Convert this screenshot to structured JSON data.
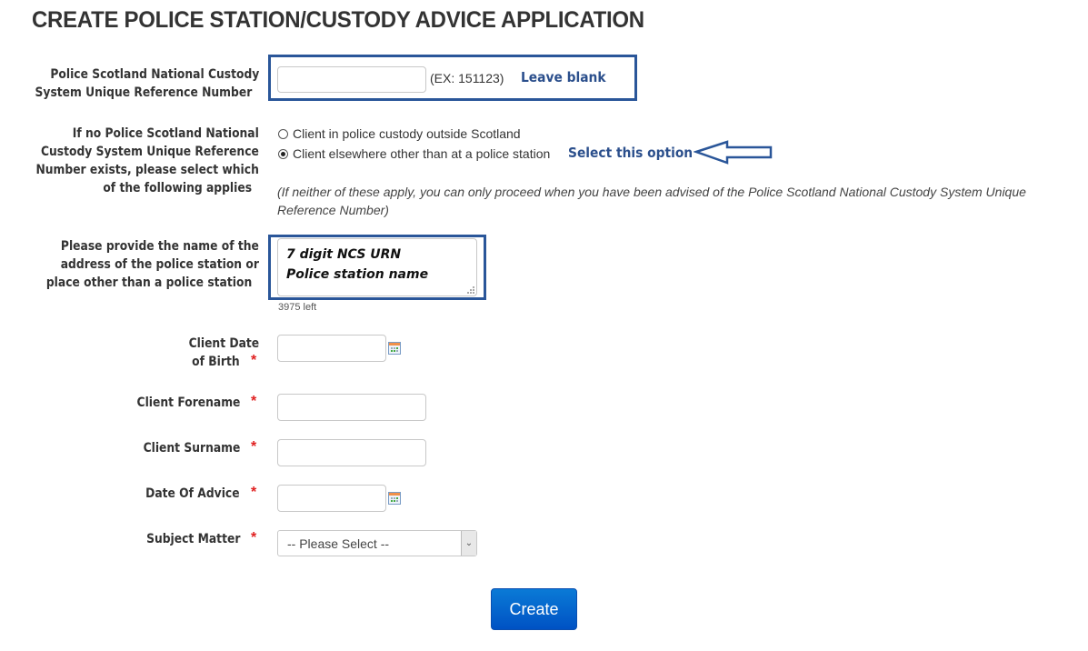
{
  "page": {
    "title": "CREATE POLICE STATION/CUSTODY ADVICE APPLICATION"
  },
  "ncs_urn": {
    "label_line1": "Police Scotland National Custody",
    "label_line2": "System Unique Reference Number",
    "value": "",
    "example": "(EX: 151123)",
    "annotation": "Leave blank"
  },
  "no_urn": {
    "label_lines": [
      "If no Police Scotland National",
      "Custody System Unique Reference",
      "Number exists, please select which",
      "of the following applies"
    ],
    "options": [
      {
        "label": "Client in police custody outside Scotland",
        "checked": false
      },
      {
        "label": "Client elsewhere other than at a police station",
        "checked": true
      }
    ],
    "annotation": "Select this option",
    "note_line1": "(If neither of these apply, you can only proceed when you have been advised of the Police Scotland National Custody System Unique",
    "note_line2": "Reference Number)"
  },
  "station": {
    "label_lines": [
      "Please provide the name of the",
      "address of the police station or",
      "place other than a police station"
    ],
    "value_lines": [
      "7 digit NCS URN",
      "Police station name"
    ],
    "counter": "3975 left"
  },
  "dob": {
    "label_line1": "Client Date",
    "label_line2": "of Birth",
    "required": "*",
    "value": ""
  },
  "forename": {
    "label": "Client Forename",
    "required": "*",
    "value": ""
  },
  "surname": {
    "label": "Client Surname",
    "required": "*",
    "value": ""
  },
  "advice_date": {
    "label": "Date Of Advice",
    "required": "*",
    "value": ""
  },
  "subject": {
    "label": "Subject Matter",
    "required": "*",
    "selected": "-- Please Select --"
  },
  "actions": {
    "create_label": "Create"
  },
  "colors": {
    "annotation": "#2a5699",
    "required": "#e02020",
    "button": "#0066cc"
  }
}
